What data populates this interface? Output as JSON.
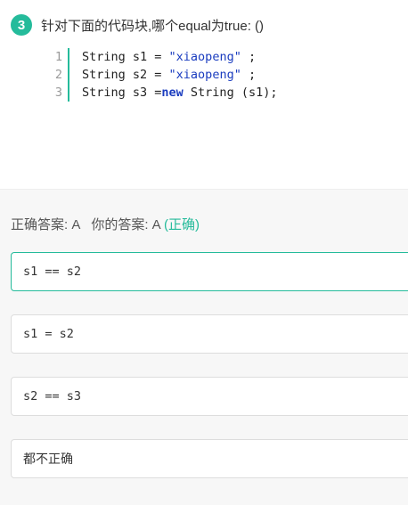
{
  "question": {
    "number": "3",
    "text": "针对下面的代码块,哪个equal为true: ()"
  },
  "code": {
    "lines": [
      {
        "no": "1",
        "parts": [
          {
            "t": "String s1 = ",
            "c": ""
          },
          {
            "t": "\"xiaopeng\"",
            "c": "str"
          },
          {
            "t": " ;",
            "c": ""
          }
        ]
      },
      {
        "no": "2",
        "parts": [
          {
            "t": "String s2 = ",
            "c": ""
          },
          {
            "t": "\"xiaopeng\"",
            "c": "str"
          },
          {
            "t": " ;",
            "c": ""
          }
        ]
      },
      {
        "no": "3",
        "parts": [
          {
            "t": "String s3 =",
            "c": ""
          },
          {
            "t": "new",
            "c": "kw"
          },
          {
            "t": " String (s1);",
            "c": ""
          }
        ]
      }
    ]
  },
  "result": {
    "correct_label": "正确答案: A",
    "your_label": "你的答案: A",
    "status": "(正确)"
  },
  "options": [
    {
      "text": "s1 == s2",
      "selected": true
    },
    {
      "text": "s1 = s2",
      "selected": false
    },
    {
      "text": "s2 == s3",
      "selected": false
    },
    {
      "text": "都不正确",
      "selected": false
    }
  ],
  "colors": {
    "accent": "#25bb9b",
    "string": "#1a3cbf"
  }
}
